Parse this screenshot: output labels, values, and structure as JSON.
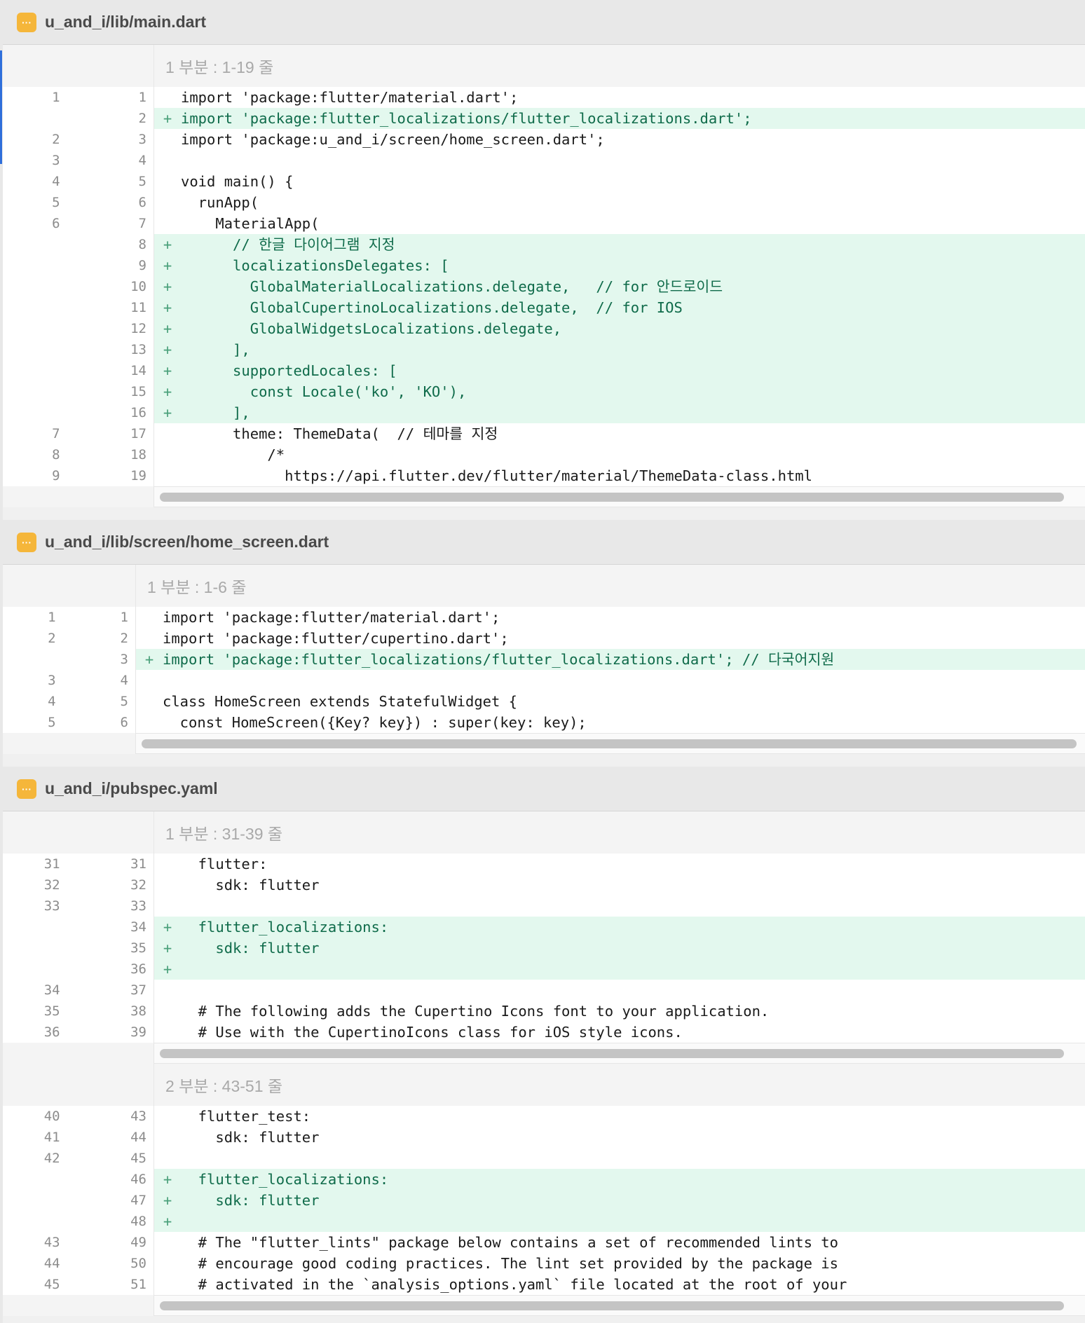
{
  "files": [
    {
      "path": "u_and_i/lib/main.dart",
      "badge": "···",
      "hunks": [
        {
          "label": "1 부분 : 1-19 줄",
          "lines": [
            {
              "old": "1",
              "new": "1",
              "add": false,
              "text": "import 'package:flutter/material.dart';"
            },
            {
              "old": "",
              "new": "2",
              "add": true,
              "text": "import 'package:flutter_localizations/flutter_localizations.dart';"
            },
            {
              "old": "2",
              "new": "3",
              "add": false,
              "text": "import 'package:u_and_i/screen/home_screen.dart';"
            },
            {
              "old": "3",
              "new": "4",
              "add": false,
              "text": ""
            },
            {
              "old": "4",
              "new": "5",
              "add": false,
              "text": "void main() {"
            },
            {
              "old": "5",
              "new": "6",
              "add": false,
              "text": "  runApp("
            },
            {
              "old": "6",
              "new": "7",
              "add": false,
              "text": "    MaterialApp("
            },
            {
              "old": "",
              "new": "8",
              "add": true,
              "text": "      // 한글 다이어그램 지정"
            },
            {
              "old": "",
              "new": "9",
              "add": true,
              "text": "      localizationsDelegates: ["
            },
            {
              "old": "",
              "new": "10",
              "add": true,
              "text": "        GlobalMaterialLocalizations.delegate,   // for 안드로이드"
            },
            {
              "old": "",
              "new": "11",
              "add": true,
              "text": "        GlobalCupertinoLocalizations.delegate,  // for IOS"
            },
            {
              "old": "",
              "new": "12",
              "add": true,
              "text": "        GlobalWidgetsLocalizations.delegate,"
            },
            {
              "old": "",
              "new": "13",
              "add": true,
              "text": "      ],"
            },
            {
              "old": "",
              "new": "14",
              "add": true,
              "text": "      supportedLocales: ["
            },
            {
              "old": "",
              "new": "15",
              "add": true,
              "text": "        const Locale('ko', 'KO'),"
            },
            {
              "old": "",
              "new": "16",
              "add": true,
              "text": "      ],"
            },
            {
              "old": "7",
              "new": "17",
              "add": false,
              "text": "      theme: ThemeData(  // 테마를 지정"
            },
            {
              "old": "8",
              "new": "18",
              "add": false,
              "text": "          /*"
            },
            {
              "old": "9",
              "new": "19",
              "add": false,
              "text": "            https://api.flutter.dev/flutter/material/ThemeData-class.html"
            }
          ]
        }
      ]
    },
    {
      "path": "u_and_i/lib/screen/home_screen.dart",
      "badge": "···",
      "hunks": [
        {
          "label": "1 부분 : 1-6 줄",
          "lines": [
            {
              "old": "1",
              "new": "1",
              "add": false,
              "text": "import 'package:flutter/material.dart';"
            },
            {
              "old": "2",
              "new": "2",
              "add": false,
              "text": "import 'package:flutter/cupertino.dart';"
            },
            {
              "old": "",
              "new": "3",
              "add": true,
              "text": "import 'package:flutter_localizations/flutter_localizations.dart'; // 다국어지원"
            },
            {
              "old": "3",
              "new": "4",
              "add": false,
              "text": ""
            },
            {
              "old": "4",
              "new": "5",
              "add": false,
              "text": "class HomeScreen extends StatefulWidget {"
            },
            {
              "old": "5",
              "new": "6",
              "add": false,
              "text": "  const HomeScreen({Key? key}) : super(key: key);"
            }
          ]
        }
      ]
    },
    {
      "path": "u_and_i/pubspec.yaml",
      "badge": "···",
      "hunks": [
        {
          "label": "1 부분 : 31-39 줄",
          "lines": [
            {
              "old": "31",
              "new": "31",
              "add": false,
              "text": "  flutter:"
            },
            {
              "old": "32",
              "new": "32",
              "add": false,
              "text": "    sdk: flutter"
            },
            {
              "old": "33",
              "new": "33",
              "add": false,
              "text": ""
            },
            {
              "old": "",
              "new": "34",
              "add": true,
              "text": "  flutter_localizations:"
            },
            {
              "old": "",
              "new": "35",
              "add": true,
              "text": "    sdk: flutter"
            },
            {
              "old": "",
              "new": "36",
              "add": true,
              "text": ""
            },
            {
              "old": "34",
              "new": "37",
              "add": false,
              "text": ""
            },
            {
              "old": "35",
              "new": "38",
              "add": false,
              "text": "  # The following adds the Cupertino Icons font to your application."
            },
            {
              "old": "36",
              "new": "39",
              "add": false,
              "text": "  # Use with the CupertinoIcons class for iOS style icons."
            }
          ]
        },
        {
          "label": "2 부분 : 43-51 줄",
          "lines": [
            {
              "old": "40",
              "new": "43",
              "add": false,
              "text": "  flutter_test:"
            },
            {
              "old": "41",
              "new": "44",
              "add": false,
              "text": "    sdk: flutter"
            },
            {
              "old": "42",
              "new": "45",
              "add": false,
              "text": ""
            },
            {
              "old": "",
              "new": "46",
              "add": true,
              "text": "  flutter_localizations:"
            },
            {
              "old": "",
              "new": "47",
              "add": true,
              "text": "    sdk: flutter"
            },
            {
              "old": "",
              "new": "48",
              "add": true,
              "text": ""
            },
            {
              "old": "43",
              "new": "49",
              "add": false,
              "text": "  # The \"flutter_lints\" package below contains a set of recommended lints to"
            },
            {
              "old": "44",
              "new": "50",
              "add": false,
              "text": "  # encourage good coding practices. The lint set provided by the package is"
            },
            {
              "old": "45",
              "new": "51",
              "add": false,
              "text": "  # activated in the `analysis_options.yaml` file located at the root of your"
            }
          ]
        }
      ]
    }
  ]
}
